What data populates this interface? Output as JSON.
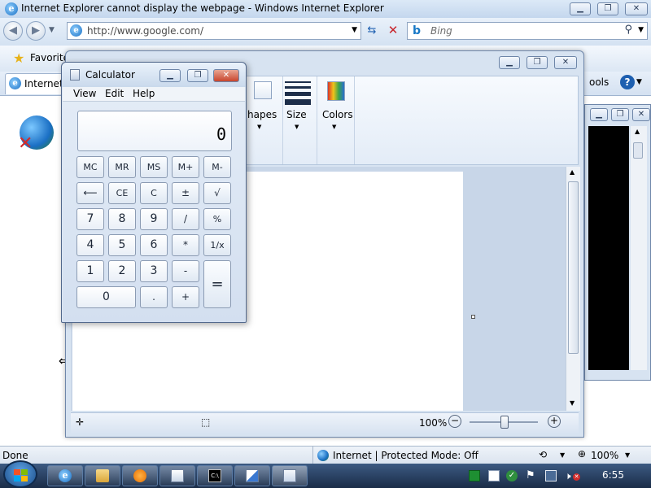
{
  "ie": {
    "title": "Internet Explorer cannot display the webpage - Windows Internet Explorer",
    "address": "http://www.google.com/",
    "search_placeholder": "Bing",
    "favorites_label": "Favorite",
    "tab_label": "Internet",
    "tools_label": "ools",
    "status_left": "Done",
    "status_zone": "Internet | Protected Mode: Off",
    "zoom": "100%"
  },
  "paint": {
    "shapes_label": "hapes",
    "size_label": "Size",
    "colors_label": "Colors",
    "zoom": "100%"
  },
  "calculator": {
    "title": "Calculator",
    "menu": [
      "View",
      "Edit",
      "Help"
    ],
    "display": "0",
    "keys": {
      "mc": "MC",
      "mr": "MR",
      "ms": "MS",
      "mplus": "M+",
      "mminus": "M-",
      "back": "⟵",
      "ce": "CE",
      "c": "C",
      "plusminus": "±",
      "sqrt": "√",
      "k7": "7",
      "k8": "8",
      "k9": "9",
      "div": "/",
      "pct": "%",
      "k4": "4",
      "k5": "5",
      "k6": "6",
      "mul": "*",
      "recip": "1/x",
      "k1": "1",
      "k2": "2",
      "k3": "3",
      "sub": "-",
      "eq": "=",
      "k0": "0",
      "dot": ".",
      "add": "+"
    }
  },
  "taskbar": {
    "clock": "6:55"
  },
  "colors": {
    "accent": "#1a6fc4",
    "error": "#d22b2b"
  }
}
